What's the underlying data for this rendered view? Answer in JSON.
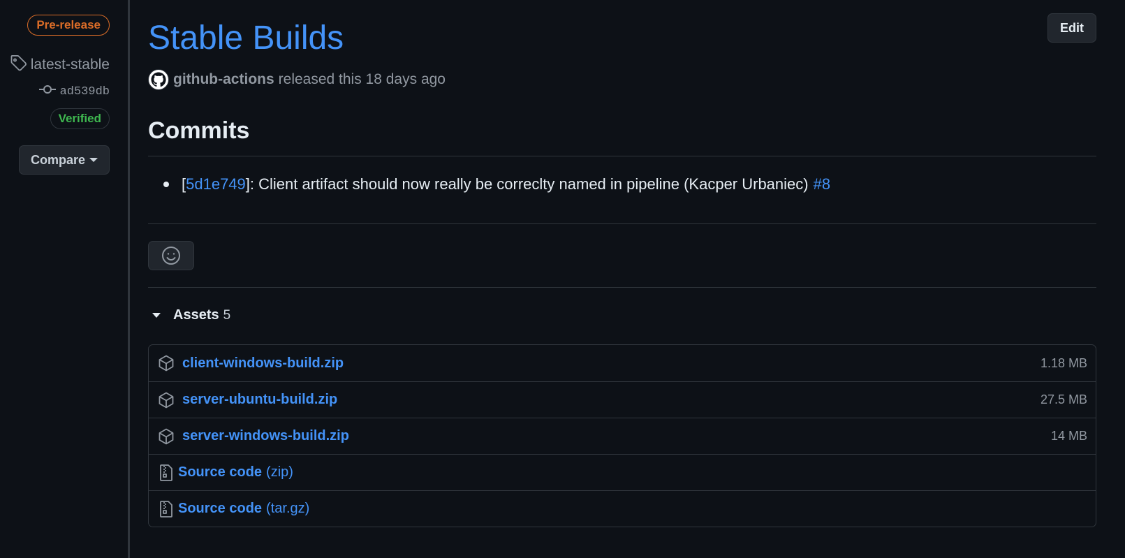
{
  "sidebar": {
    "prerelease_label": "Pre-release",
    "tag_name": "latest-stable",
    "commit_sha": "ad539db",
    "verified_label": "Verified",
    "compare_label": "Compare"
  },
  "release": {
    "title": "Stable Builds",
    "edit_label": "Edit",
    "author": "github-actions",
    "released_text": "released this 18 days ago"
  },
  "commits": {
    "heading": "Commits",
    "items": [
      {
        "open_bracket": "[",
        "sha": "5d1e749",
        "message": "]: Client artifact should now really be correclty named in pipeline (Kacper Urbaniec)",
        "pr": "#8"
      }
    ]
  },
  "assets": {
    "label": "Assets",
    "count": "5",
    "files": [
      {
        "name": "client-windows-build.zip",
        "size": "1.18 MB",
        "icon": "package-icon"
      },
      {
        "name": "server-ubuntu-build.zip",
        "size": "27.5 MB",
        "icon": "package-icon"
      },
      {
        "name": "server-windows-build.zip",
        "size": "14 MB",
        "icon": "package-icon"
      }
    ],
    "source": [
      {
        "name": "Source code",
        "format": "(zip)",
        "icon": "file-zip-icon"
      },
      {
        "name": "Source code",
        "format": "(tar.gz)",
        "icon": "file-zip-icon"
      }
    ]
  },
  "colors": {
    "background": "#0d1117",
    "link": "#4493f8",
    "prerelease": "#db6d28",
    "verified": "#3fb950",
    "border": "#30363d"
  }
}
